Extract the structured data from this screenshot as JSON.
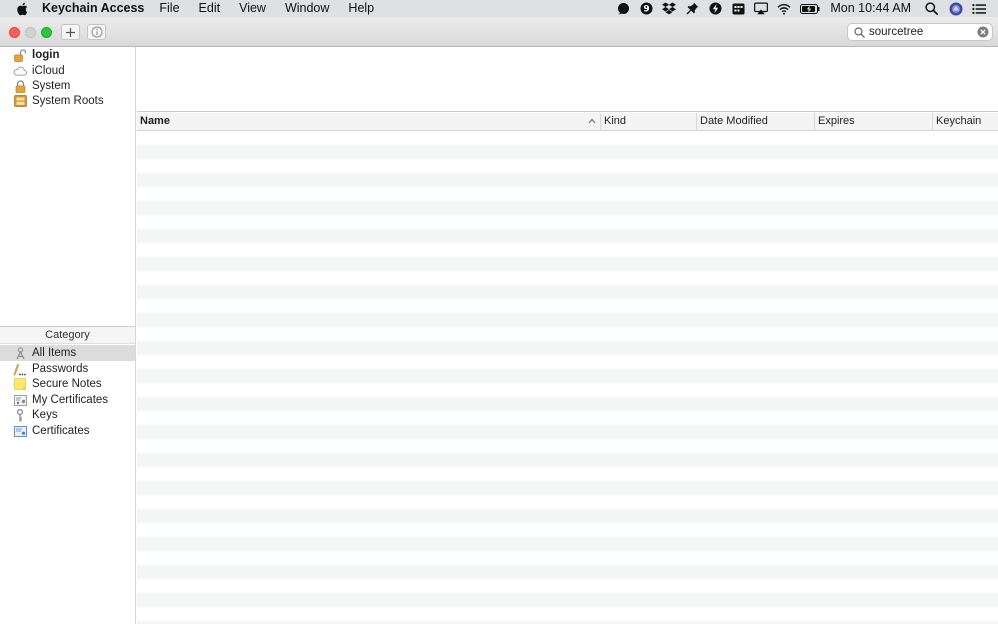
{
  "menubar": {
    "app_name": "Keychain Access",
    "menus": [
      "File",
      "Edit",
      "View",
      "Window",
      "Help"
    ],
    "status_icons": [
      "pill-icon",
      "badge-nine-icon",
      "dropbox-icon",
      "pin-icon",
      "bolt-icon",
      "calendar-icon",
      "airplay-icon",
      "wifi-icon",
      "battery-icon"
    ],
    "badge_number": "9",
    "clock": "Mon 10:44 AM"
  },
  "toolbar": {
    "search": {
      "value": "sourcetree"
    }
  },
  "sidebar": {
    "keychains": [
      {
        "label": "login",
        "icon": "unlocked-padlock-icon"
      },
      {
        "label": "iCloud",
        "icon": "cloud-icon"
      },
      {
        "label": "System",
        "icon": "padlock-icon"
      },
      {
        "label": "System Roots",
        "icon": "cabinet-icon"
      }
    ],
    "category_header": "Category",
    "categories": [
      {
        "label": "All Items",
        "icon": "all-items-icon",
        "selected": true
      },
      {
        "label": "Passwords",
        "icon": "password-icon"
      },
      {
        "label": "Secure Notes",
        "icon": "note-icon"
      },
      {
        "label": "My Certificates",
        "icon": "my-certificate-icon"
      },
      {
        "label": "Keys",
        "icon": "key-icon"
      },
      {
        "label": "Certificates",
        "icon": "certificate-icon"
      }
    ]
  },
  "table": {
    "columns": {
      "name": "Name",
      "kind": "Kind",
      "date_modified": "Date Modified",
      "expires": "Expires",
      "keychain": "Keychain"
    },
    "sort": {
      "column": "name",
      "direction": "ascending"
    },
    "rows": []
  },
  "colors": {
    "close": "#fe5f57",
    "minimize_inactive": "#d1d1d1",
    "zoom": "#28c840",
    "selection": "#dcdcdc",
    "row_stripe": "#f4f5f5"
  }
}
